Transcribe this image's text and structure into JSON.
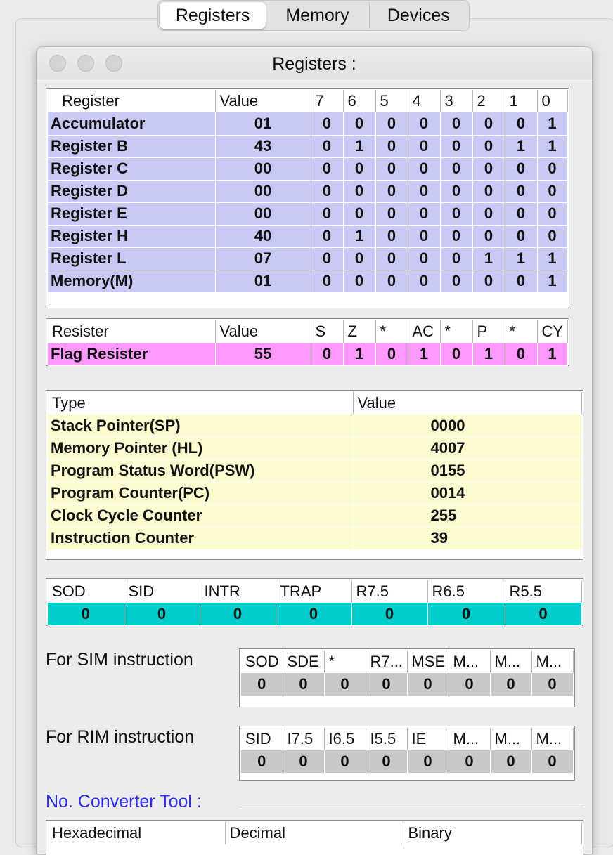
{
  "tabs": [
    "Registers",
    "Memory",
    "Devices"
  ],
  "window": {
    "title": "Registers :"
  },
  "registers": {
    "headers": [
      "Register",
      "Value",
      "7",
      "6",
      "5",
      "4",
      "3",
      "2",
      "1",
      "0"
    ],
    "rows": [
      {
        "name": "Accumulator",
        "value": "01",
        "bits": [
          "0",
          "0",
          "0",
          "0",
          "0",
          "0",
          "0",
          "1"
        ]
      },
      {
        "name": "Register B",
        "value": "43",
        "bits": [
          "0",
          "1",
          "0",
          "0",
          "0",
          "0",
          "1",
          "1"
        ]
      },
      {
        "name": "Register C",
        "value": "00",
        "bits": [
          "0",
          "0",
          "0",
          "0",
          "0",
          "0",
          "0",
          "0"
        ]
      },
      {
        "name": "Register D",
        "value": "00",
        "bits": [
          "0",
          "0",
          "0",
          "0",
          "0",
          "0",
          "0",
          "0"
        ]
      },
      {
        "name": "Register E",
        "value": "00",
        "bits": [
          "0",
          "0",
          "0",
          "0",
          "0",
          "0",
          "0",
          "0"
        ]
      },
      {
        "name": "Register H",
        "value": "40",
        "bits": [
          "0",
          "1",
          "0",
          "0",
          "0",
          "0",
          "0",
          "0"
        ]
      },
      {
        "name": "Register L",
        "value": "07",
        "bits": [
          "0",
          "0",
          "0",
          "0",
          "0",
          "1",
          "1",
          "1"
        ]
      },
      {
        "name": "Memory(M)",
        "value": "01",
        "bits": [
          "0",
          "0",
          "0",
          "0",
          "0",
          "0",
          "0",
          "1"
        ]
      }
    ]
  },
  "flags": {
    "headers": [
      "Resister",
      "Value",
      "S",
      "Z",
      "*",
      "AC",
      "*",
      "P",
      "*",
      "CY"
    ],
    "row": {
      "name": "Flag Resister",
      "value": "55",
      "bits": [
        "0",
        "1",
        "0",
        "1",
        "0",
        "1",
        "0",
        "1"
      ]
    }
  },
  "pointers": {
    "headers": [
      "Type",
      "Value"
    ],
    "rows": [
      {
        "name": "Stack Pointer(SP)",
        "value": "0000"
      },
      {
        "name": "Memory Pointer (HL)",
        "value": "4007"
      },
      {
        "name": "Program Status Word(PSW)",
        "value": "0155"
      },
      {
        "name": "Program Counter(PC)",
        "value": "0014"
      },
      {
        "name": "Clock Cycle Counter",
        "value": "255"
      },
      {
        "name": "Instruction Counter",
        "value": "39"
      }
    ]
  },
  "io": {
    "headers": [
      "SOD",
      "SID",
      "INTR",
      "TRAP",
      "R7.5",
      "R6.5",
      "R5.5"
    ],
    "values": [
      "0",
      "0",
      "0",
      "0",
      "0",
      "0",
      "0"
    ]
  },
  "sim": {
    "label": "For SIM instruction",
    "headers": [
      "SOD",
      "SDE",
      "*",
      "R7...",
      "MSE",
      "M...",
      "M...",
      "M..."
    ],
    "values": [
      "0",
      "0",
      "0",
      "0",
      "0",
      "0",
      "0",
      "0"
    ]
  },
  "rim": {
    "label": "For RIM instruction",
    "headers": [
      "SID",
      "I7.5",
      "I6.5",
      "I5.5",
      "IE",
      "M...",
      "M...",
      "M..."
    ],
    "values": [
      "0",
      "0",
      "0",
      "0",
      "0",
      "0",
      "0",
      "0"
    ]
  },
  "converter": {
    "title": "No. Converter Tool :",
    "headers": [
      "Hexadecimal",
      "Decimal",
      "Binary"
    ]
  },
  "colors": {
    "register_row": "#c9c9f5",
    "flag_row": "#ff99ff",
    "pointer_row": "#fcfcd0",
    "io_row": "#00cccc",
    "sim_row": "#c8c8c8",
    "converter_title": "#2d2df5"
  }
}
